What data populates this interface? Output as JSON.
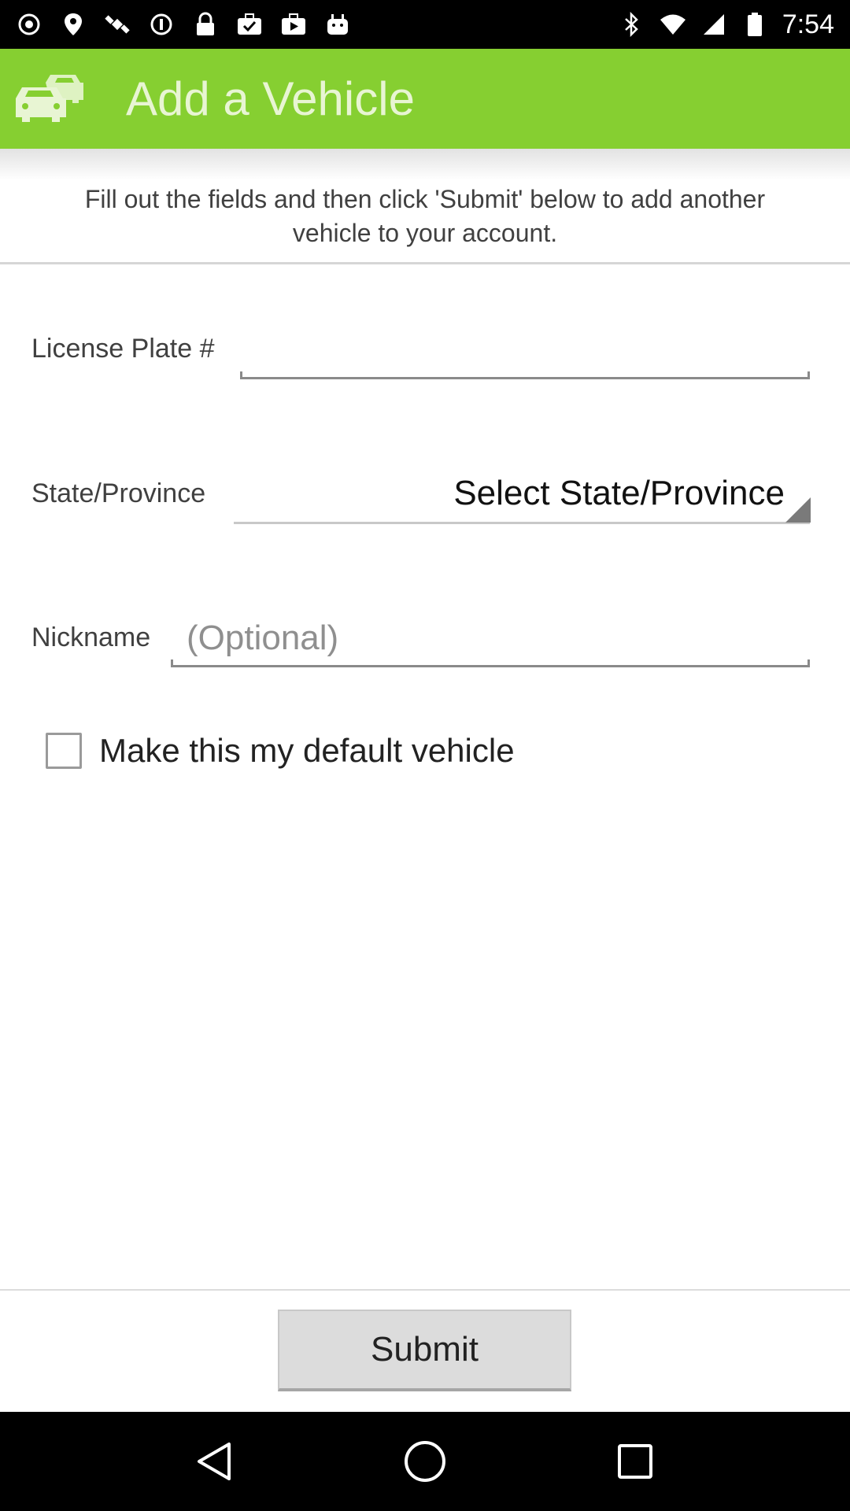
{
  "status_bar": {
    "time": "7:54",
    "icons": [
      "record-icon",
      "fake-gps-icon",
      "satellite-icon",
      "sync-icon",
      "lock-icon",
      "check-bag-icon",
      "play-store-icon",
      "android-icon",
      "bluetooth-icon",
      "wifi-icon",
      "signal-icon",
      "battery-icon"
    ]
  },
  "app_bar": {
    "title": "Add a Vehicle",
    "icon": "cars-icon",
    "color": "#86cf31"
  },
  "intro_text": "Fill out the fields and then click 'Submit' below to add another vehicle to your account.",
  "form": {
    "license_plate": {
      "label": "License Plate #",
      "value": "",
      "placeholder": ""
    },
    "state_province": {
      "label": "State/Province",
      "selected": "Select State/Province"
    },
    "nickname": {
      "label": "Nickname",
      "value": "",
      "placeholder": "(Optional)"
    },
    "default_vehicle": {
      "label": "Make this my default vehicle",
      "checked": false
    }
  },
  "submit_label": "Submit",
  "nav": {
    "back": "back-icon",
    "home": "home-icon",
    "recents": "recents-icon"
  }
}
